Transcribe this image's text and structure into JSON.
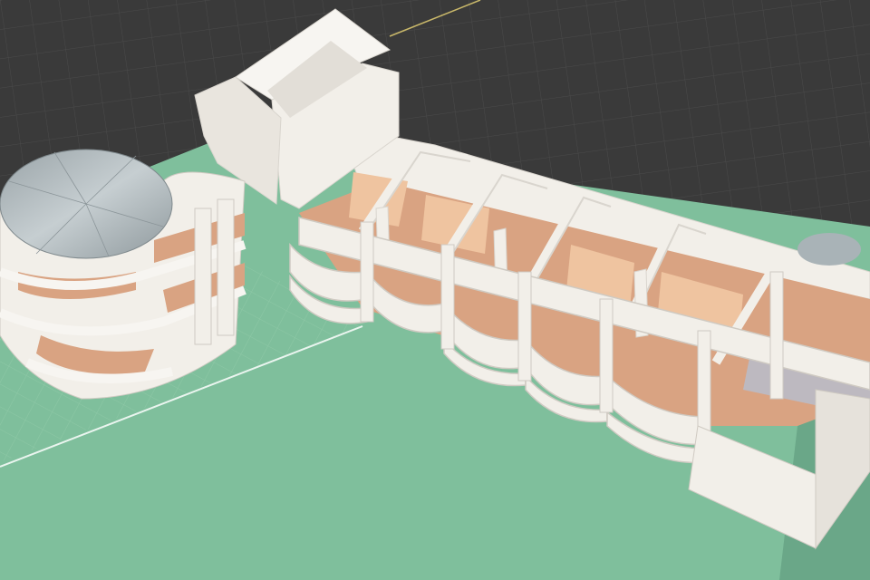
{
  "scene": {
    "kind": "3d-viewport-render",
    "subject": "architectural-model",
    "colors": {
      "viewport_bg": "#3a3a3a",
      "grid_line": "#4a4a4a",
      "ground_plane": "#7fbf9c",
      "ground_plane_dark": "#6aa788",
      "ground_grid": "#93ccaa",
      "wall_white": "#f2efe9",
      "wall_shadow": "#d9d5ce",
      "roof_gray": "#a9b3b7",
      "floor_salmon": "#d9a382",
      "floor_peach": "#efc4a0",
      "interior_gray": "#bdb9c0",
      "axis_line": "#c9b86a"
    }
  }
}
